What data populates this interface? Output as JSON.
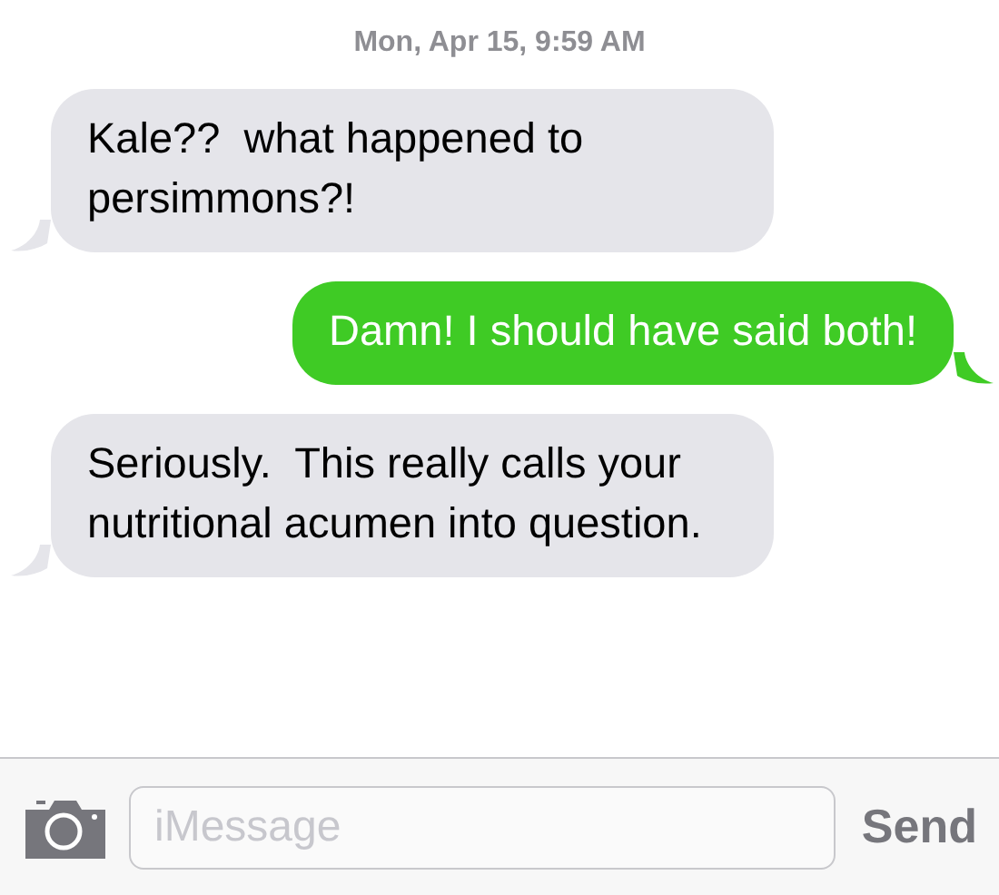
{
  "timestamp": "Mon, Apr 15, 9:59 AM",
  "messages": [
    {
      "kind": "received",
      "text": "Kale??  what happened to persimmons?!"
    },
    {
      "kind": "sent",
      "text": "Damn! I should have said both!"
    },
    {
      "kind": "received",
      "text": "Seriously.  This really calls your nutritional acumen into question."
    }
  ],
  "composer": {
    "placeholder": "iMessage",
    "send": "Send"
  }
}
